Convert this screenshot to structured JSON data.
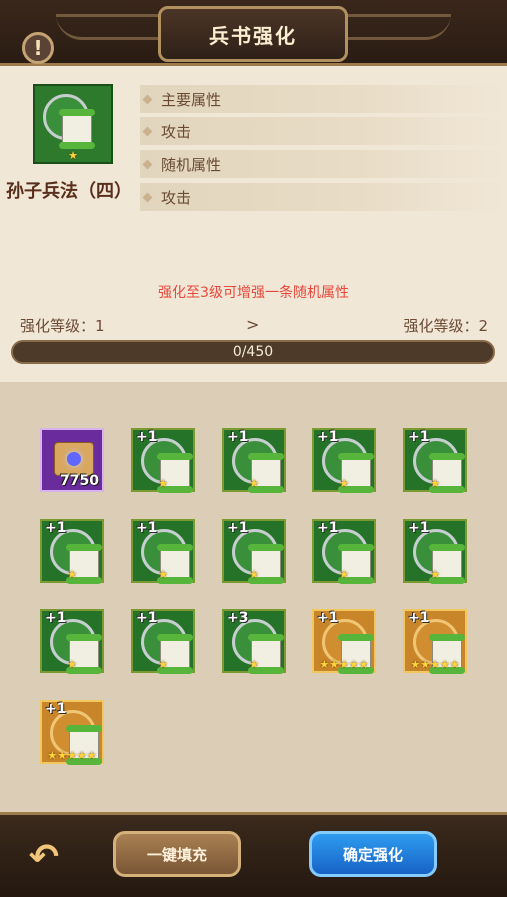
{
  "header": {
    "title": "兵书强化",
    "warn_icon": "!"
  },
  "book": {
    "name": "孙子兵法（四）",
    "icon": "scroll-icon",
    "stars": "★"
  },
  "attributes": [
    "主要属性",
    "攻击",
    "随机属性",
    "攻击"
  ],
  "notice": "强化至3级可增强一条随机属性",
  "level": {
    "current_label": "强化等级：1",
    "next_label": "强化等级：2",
    "arrow": ">",
    "progress_text": "0/450",
    "progress_value": 0,
    "progress_max": 450
  },
  "grid_items": [
    {
      "type": "purple",
      "count": "7750"
    },
    {
      "type": "green",
      "plus": "+1",
      "stars": "★"
    },
    {
      "type": "green",
      "plus": "+1",
      "stars": "★"
    },
    {
      "type": "green",
      "plus": "+1",
      "stars": "★"
    },
    {
      "type": "green",
      "plus": "+1",
      "stars": "★"
    },
    {
      "type": "green",
      "plus": "+1",
      "stars": "★"
    },
    {
      "type": "green",
      "plus": "+1",
      "stars": "★"
    },
    {
      "type": "green",
      "plus": "+1",
      "stars": "★"
    },
    {
      "type": "green",
      "plus": "+1",
      "stars": "★"
    },
    {
      "type": "green",
      "plus": "+1",
      "stars": "★"
    },
    {
      "type": "green",
      "plus": "+1",
      "stars": "★"
    },
    {
      "type": "green",
      "plus": "+1",
      "stars": "★"
    },
    {
      "type": "green",
      "plus": "+3",
      "stars": "★"
    },
    {
      "type": "gold",
      "plus": "+1",
      "stars": "★★★★★"
    },
    {
      "type": "gold",
      "plus": "+1",
      "stars": "★★★★★"
    },
    {
      "type": "gold",
      "plus": "+1",
      "stars": "★★★★★"
    }
  ],
  "footer": {
    "back_icon": "back-arrow-icon",
    "fill_label": "一键填充",
    "confirm_label": "确定强化"
  }
}
